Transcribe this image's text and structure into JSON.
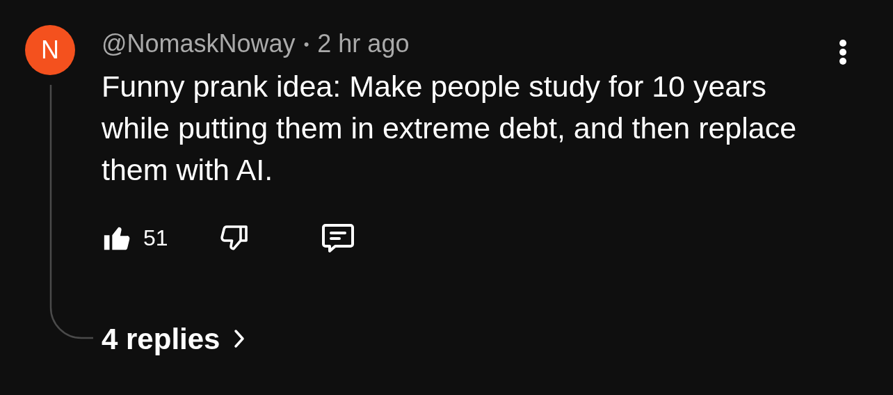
{
  "comment": {
    "avatar_letter": "N",
    "author": "@NomaskNoway",
    "separator": "•",
    "time": "2 hr ago",
    "text": "Funny prank idea: Make people study for 10 years while putting them in extreme debt, and then replace them with AI.",
    "liked": true,
    "disliked": false,
    "like_count": "51",
    "replies_label": "4 replies"
  }
}
